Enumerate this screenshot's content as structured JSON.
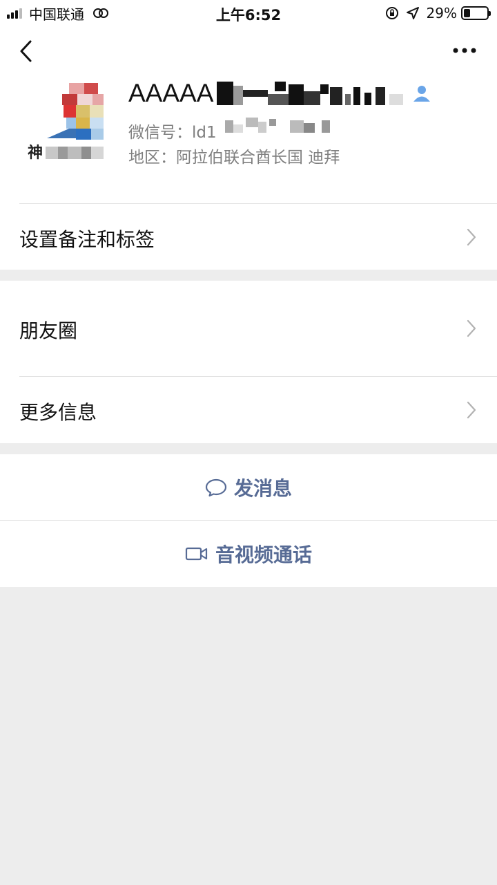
{
  "status_bar": {
    "carrier": "中国联通",
    "time": "上午6:52",
    "battery_percent": "29%",
    "battery_level": 0.29
  },
  "profile": {
    "name_visible": "AAAAA",
    "wechat_id_label": "微信号：",
    "wechat_id_visible": "ld1",
    "region_label": "地区：",
    "region_value": "阿拉伯联合酋长国 迪拜",
    "avatar_text": "神"
  },
  "menu": {
    "remarks_tags": "设置备注和标签",
    "moments": "朋友圈",
    "more_info": "更多信息"
  },
  "actions": {
    "send_message": "发消息",
    "av_call": "音视频通话"
  },
  "colors": {
    "accent": "#576b95",
    "background": "#ededed",
    "contact_icon": "#6aa5e8"
  },
  "icons": [
    "back-icon",
    "more-icon",
    "contact-icon",
    "chevron-right-icon",
    "chat-bubble-icon",
    "video-camera-icon"
  ]
}
